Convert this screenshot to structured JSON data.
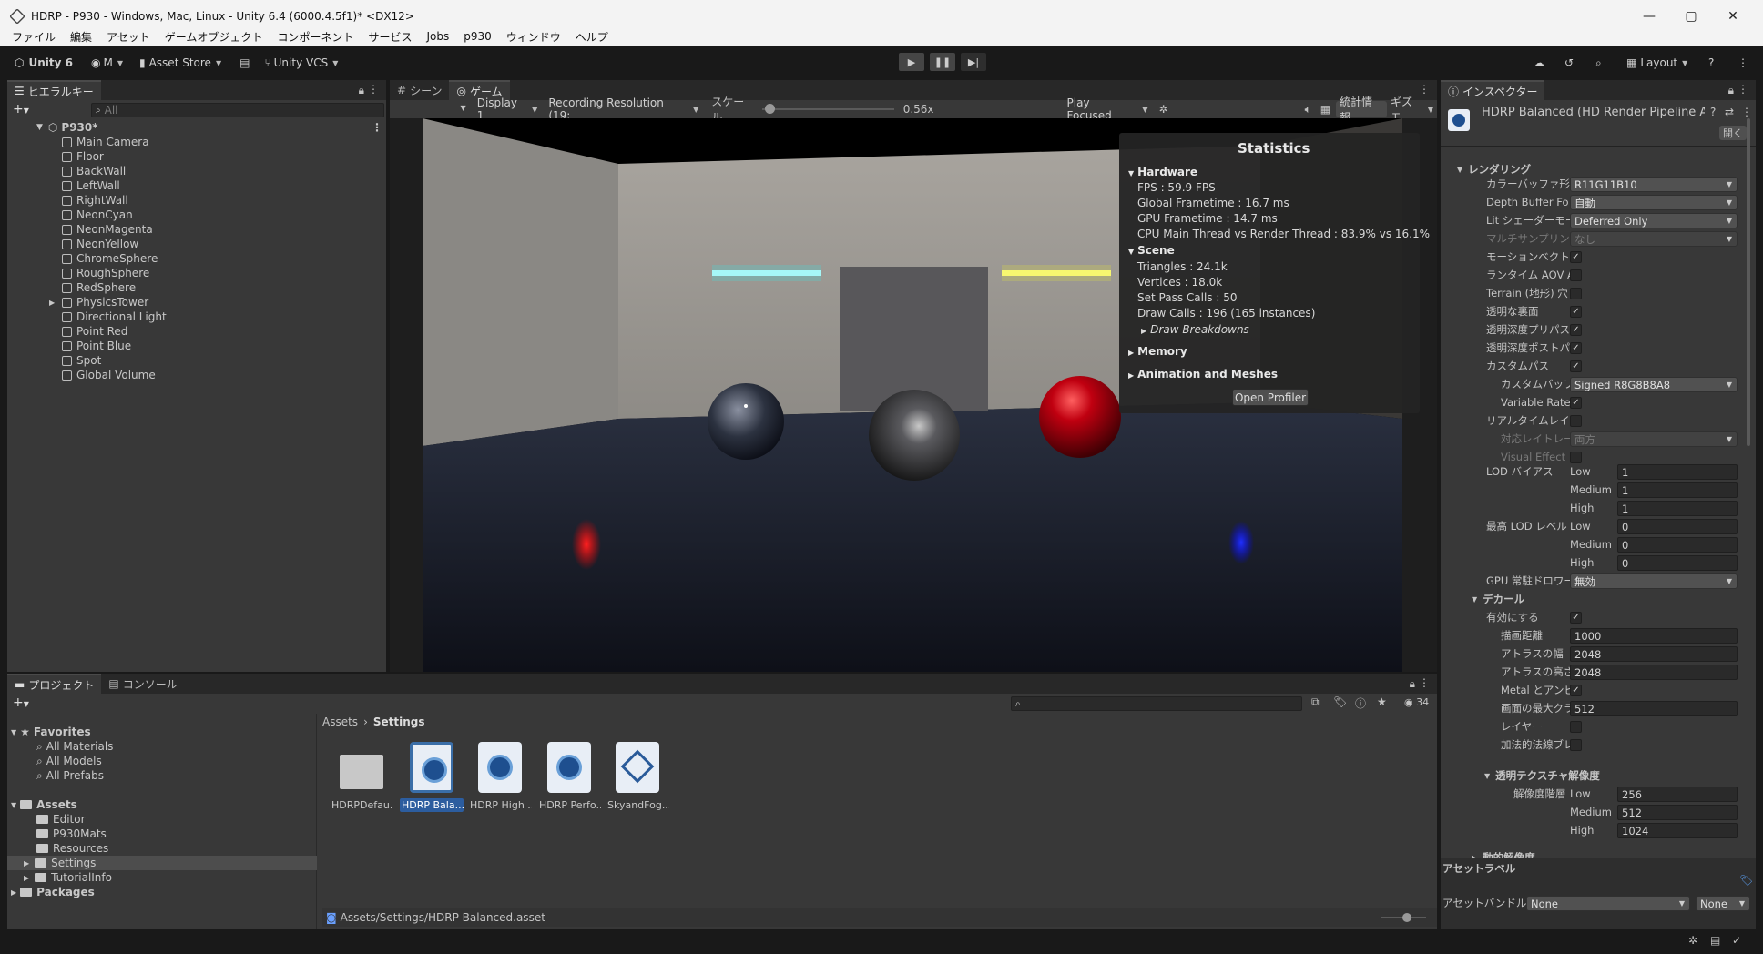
{
  "window": {
    "title": "HDRP - P930 - Windows, Mac, Linux - Unity 6.4 (6000.4.5f1)* <DX12>"
  },
  "menu": [
    "ファイル",
    "編集",
    "アセット",
    "ゲームオブジェクト",
    "コンポーネント",
    "サービス",
    "Jobs",
    "p930",
    "ウィンドウ",
    "ヘルプ"
  ],
  "toolbar": {
    "unity": "Unity 6",
    "account": "M",
    "asset_store": "Asset Store",
    "vcs": "Unity VCS",
    "layout": "Layout"
  },
  "hierarchy": {
    "tab": "ヒエラルキー",
    "search_placeholder": "All",
    "scene": "P930*",
    "items": [
      "Main Camera",
      "Floor",
      "BackWall",
      "LeftWall",
      "RightWall",
      "NeonCyan",
      "NeonMagenta",
      "NeonYellow",
      "ChromeSphere",
      "RoughSphere",
      "RedSphere",
      "PhysicsTower",
      "Directional Light",
      "Point Red",
      "Point Blue",
      "Spot",
      "Global Volume"
    ]
  },
  "game": {
    "tabs": [
      "シーン",
      "ゲーム"
    ],
    "display": "Display 1",
    "resolution": "Recording Resolution (19:",
    "scale_label": "スケール",
    "scale_value": "0.56x",
    "scale_fraction": 0.02,
    "play_mode": "Play Focused",
    "stats_button": "統計情報",
    "gizmos_button": "ギズモ"
  },
  "stats": {
    "title": "Statistics",
    "hardware": "Hardware",
    "fps": "FPS : 59.9 FPS",
    "global_frametime": "Global Frametime : 16.7 ms",
    "gpu_frametime": "GPU Frametime : 14.7 ms",
    "cpu_main": "CPU Main Thread vs Render Thread : 83.9% vs 16.1%",
    "scene": "Scene",
    "triangles": "Triangles : 24.1k",
    "vertices": "Vertices : 18.0k",
    "setpass": "Set Pass Calls : 50",
    "drawcalls": "Draw Calls : 196 (165 instances)",
    "breakdowns": "Draw Breakdowns",
    "memory": "Memory",
    "animation": "Animation and Meshes",
    "open_profiler": "Open Profiler"
  },
  "project": {
    "tabs": [
      "プロジェクト",
      "コンソール"
    ],
    "favorites": "Favorites",
    "fav_items": [
      "All Materials",
      "All Models",
      "All Prefabs"
    ],
    "assets": "Assets",
    "asset_folders": [
      "Editor",
      "P930Mats",
      "Resources",
      "Settings",
      "TutorialInfo"
    ],
    "packages": "Packages",
    "breadcrumb_root": "Assets",
    "breadcrumb_current": "Settings",
    "count": "34",
    "files": [
      "HDRPDefau...",
      "HDRP Bala...",
      "HDRP High ...",
      "HDRP Perfo...",
      "SkyandFog..."
    ],
    "path": "Assets/Settings/HDRP Balanced.asset"
  },
  "inspector": {
    "tab": "インスペクター",
    "title": "HDRP Balanced (HD Render Pipeline A",
    "open": "開く",
    "rendering": "レンダリング",
    "rows": [
      {
        "label": "カラーバッファ形式",
        "value": "R11G11B10"
      },
      {
        "label": "Depth Buffer Fo",
        "value": "自動"
      },
      {
        "label": "Lit シェーダーモード",
        "value": "Deferred Only"
      },
      {
        "label": "マルチサンプリン",
        "value": "なし"
      },
      {
        "label": "モーションベクトル",
        "value": ""
      },
      {
        "label": "ランタイム AOV AP",
        "value": ""
      },
      {
        "label": "Terrain (地形) 穴",
        "value": ""
      },
      {
        "label": "透明な裏面",
        "value": ""
      },
      {
        "label": "透明深度プリパス",
        "value": ""
      },
      {
        "label": "透明深度ポストパ",
        "value": ""
      },
      {
        "label": "カスタムパス",
        "value": ""
      },
      {
        "label": "カスタムバッファ形",
        "value": "Signed R8G8B8A8"
      },
      {
        "label": "Variable Rate",
        "value": ""
      },
      {
        "label": "リアルタイムレイトレ",
        "value": ""
      },
      {
        "label": "対応レイトレーシ",
        "value": "両方"
      },
      {
        "label": "Visual Effect",
        "value": ""
      }
    ],
    "lod_bias": "LOD バイアス",
    "lod_levels": [
      "Low",
      "Medium",
      "High"
    ],
    "lod_bias_values": [
      "1",
      "1",
      "1"
    ],
    "max_lod": "最高 LOD レベル",
    "max_lod_values": [
      "0",
      "0",
      "0"
    ],
    "gpu_driven": "GPU 常駐ドロワー",
    "gpu_driven_value": "無効",
    "decal": "デカール",
    "decal_rows": [
      {
        "label": "有効にする",
        "value": ""
      },
      {
        "label": "描画距離",
        "value": "1000"
      },
      {
        "label": "アトラスの幅",
        "value": "2048"
      },
      {
        "label": "アトラスの高さ",
        "value": "2048"
      },
      {
        "label": "Metal とアンビエ",
        "value": ""
      },
      {
        "label": "画面の最大クラ",
        "value": "512"
      },
      {
        "label": "レイヤー",
        "value": ""
      },
      {
        "label": "加法的法線ブレ",
        "value": ""
      }
    ],
    "transparent_tex": "透明テクスチャ解像度",
    "res_tier": "解像度階層",
    "res_values": [
      "256",
      "512",
      "1024"
    ],
    "dynamic_res": "動的解像度",
    "asset_labels": "アセットラベル",
    "asset_bundle": "アセットバンドル",
    "bundle_value": "None",
    "bundle_variant": "None"
  }
}
